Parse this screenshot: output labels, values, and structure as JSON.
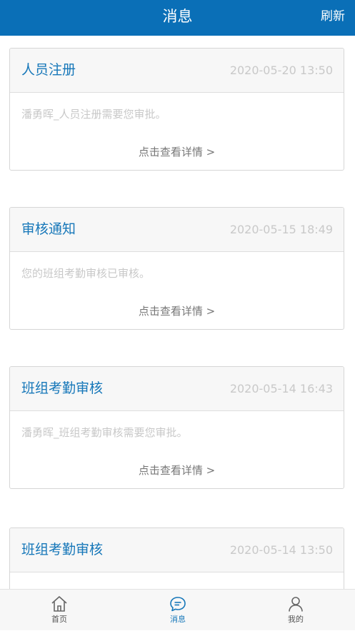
{
  "header": {
    "title": "消息",
    "refresh_label": "刷新"
  },
  "messages": [
    {
      "title": "人员注册",
      "time": "2020-05-20 13:50",
      "body": "潘勇晖_人员注册需要您审批。",
      "link": "点击查看详情 >"
    },
    {
      "title": "审核通知",
      "time": "2020-05-15 18:49",
      "body": "您的班组考勤审核已审核。",
      "link": "点击查看详情 >"
    },
    {
      "title": "班组考勤审核",
      "time": "2020-05-14 16:43",
      "body": "潘勇晖_班组考勤审核需要您审批。",
      "link": "点击查看详情 >"
    },
    {
      "title": "班组考勤审核",
      "time": "2020-05-14 13:50",
      "body": "",
      "link": ""
    }
  ],
  "tabs": [
    {
      "label": "首页",
      "icon": "home-icon",
      "active": false
    },
    {
      "label": "消息",
      "icon": "message-icon",
      "active": true
    },
    {
      "label": "我的",
      "icon": "profile-icon",
      "active": false
    }
  ],
  "colors": {
    "brand": "#0a6fb7",
    "title": "#1677b9",
    "muted": "#c8c8c8"
  }
}
